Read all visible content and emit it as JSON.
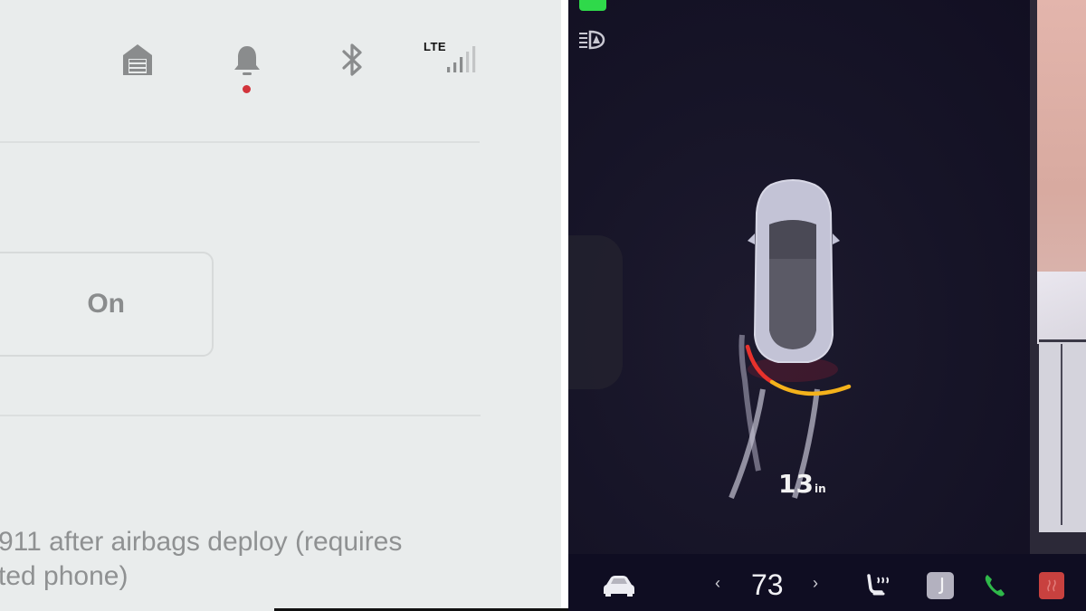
{
  "settings_panel": {
    "status_bar": {
      "icons": [
        "garage-icon",
        "bell-icon",
        "bluetooth-icon",
        "lte-signal-icon"
      ],
      "network_label": "LTE",
      "notification_dot_color": "#d2343b"
    },
    "toggle": {
      "label": "On"
    },
    "description": "911 after airbags deploy (requires",
    "description_line2": "ted phone)"
  },
  "car_display": {
    "indicators": [
      "green-light-indicator",
      "auto-headlight-icon"
    ],
    "parking_distance": {
      "value": "13",
      "unit": "in",
      "arc_colors": [
        "#e8322c",
        "#f4b21b"
      ]
    },
    "dock": {
      "icons": [
        "car-icon",
        "seat-heater-icon",
        "music-icon",
        "phone-icon",
        "rear-defrost-icon"
      ],
      "temperature": "73",
      "temp_decrease": "‹",
      "temp_increase": "›",
      "phone_color": "#2fb84a",
      "defrost_color": "#c8413f"
    }
  }
}
